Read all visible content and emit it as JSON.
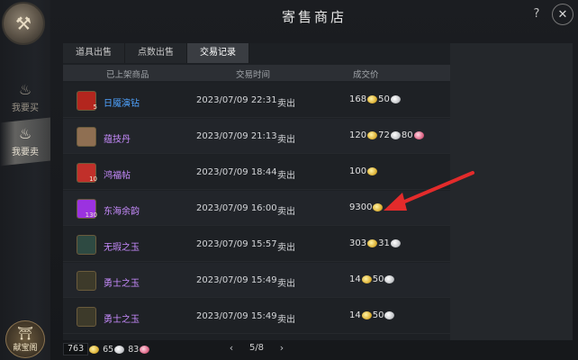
{
  "left_rail": {
    "logo_glyph": "⚒",
    "items": [
      {
        "label": "我要买",
        "glyph": "♨"
      },
      {
        "label": "我要卖",
        "glyph": "♨"
      }
    ],
    "bottom": {
      "label": "献宝阁",
      "glyph": "⛩"
    }
  },
  "window": {
    "title": "寄售商店",
    "help_label": "?",
    "close_label": "✕"
  },
  "tabs": [
    {
      "label": "道具出售",
      "active": false
    },
    {
      "label": "点数出售",
      "active": false
    },
    {
      "label": "交易记录",
      "active": true
    }
  ],
  "table": {
    "headers": {
      "item": "已上架商品",
      "time": "交易时间",
      "price": "成交价"
    },
    "rows": [
      {
        "name": "日魇演钻",
        "name_color": "#4fa3ff",
        "icon_color": "#b3261e",
        "qty": "5",
        "time": "2023/07/09  22:31",
        "type": "卖出",
        "price": [
          {
            "amount": "168",
            "coin": "gold"
          },
          {
            "amount": "50",
            "coin": "silver"
          }
        ]
      },
      {
        "name": "蕴技丹",
        "name_color": "#c88cff",
        "icon_color": "#8f6f52",
        "qty": "",
        "time": "2023/07/09  21:13",
        "type": "卖出",
        "price": [
          {
            "amount": "120",
            "coin": "gold"
          },
          {
            "amount": "72",
            "coin": "silver"
          },
          {
            "amount": "80",
            "coin": "pink"
          }
        ]
      },
      {
        "name": "鸿福帖",
        "name_color": "#c88cff",
        "icon_color": "#c1302a",
        "qty": "10",
        "time": "2023/07/09  18:44",
        "type": "卖出",
        "price": [
          {
            "amount": "100",
            "coin": "gold"
          }
        ]
      },
      {
        "name": "东海余韵",
        "name_color": "#c88cff",
        "icon_color": "#9b32e0",
        "qty": "130",
        "time": "2023/07/09  16:00",
        "type": "卖出",
        "price": [
          {
            "amount": "9300",
            "coin": "gold"
          }
        ]
      },
      {
        "name": "无瑕之玉",
        "name_color": "#c88cff",
        "icon_color": "#2e4a42",
        "qty": "",
        "time": "2023/07/09  15:57",
        "type": "卖出",
        "price": [
          {
            "amount": "303",
            "coin": "gold"
          },
          {
            "amount": "31",
            "coin": "silver"
          }
        ]
      },
      {
        "name": "勇士之玉",
        "name_color": "#c88cff",
        "icon_color": "#3d3a2a",
        "qty": "",
        "time": "2023/07/09  15:49",
        "type": "卖出",
        "price": [
          {
            "amount": "14",
            "coin": "gold"
          },
          {
            "amount": "50",
            "coin": "silver"
          }
        ]
      },
      {
        "name": "勇士之玉",
        "name_color": "#c88cff",
        "icon_color": "#3d3a2a",
        "qty": "",
        "time": "2023/07/09  15:49",
        "type": "卖出",
        "price": [
          {
            "amount": "14",
            "coin": "gold"
          },
          {
            "amount": "50",
            "coin": "silver"
          }
        ]
      }
    ]
  },
  "footer": {
    "gold": "763",
    "silver": "65",
    "pink": "83",
    "page": "5/8",
    "prev": "‹",
    "next": "›"
  },
  "annotation_color": "#e32b2b"
}
